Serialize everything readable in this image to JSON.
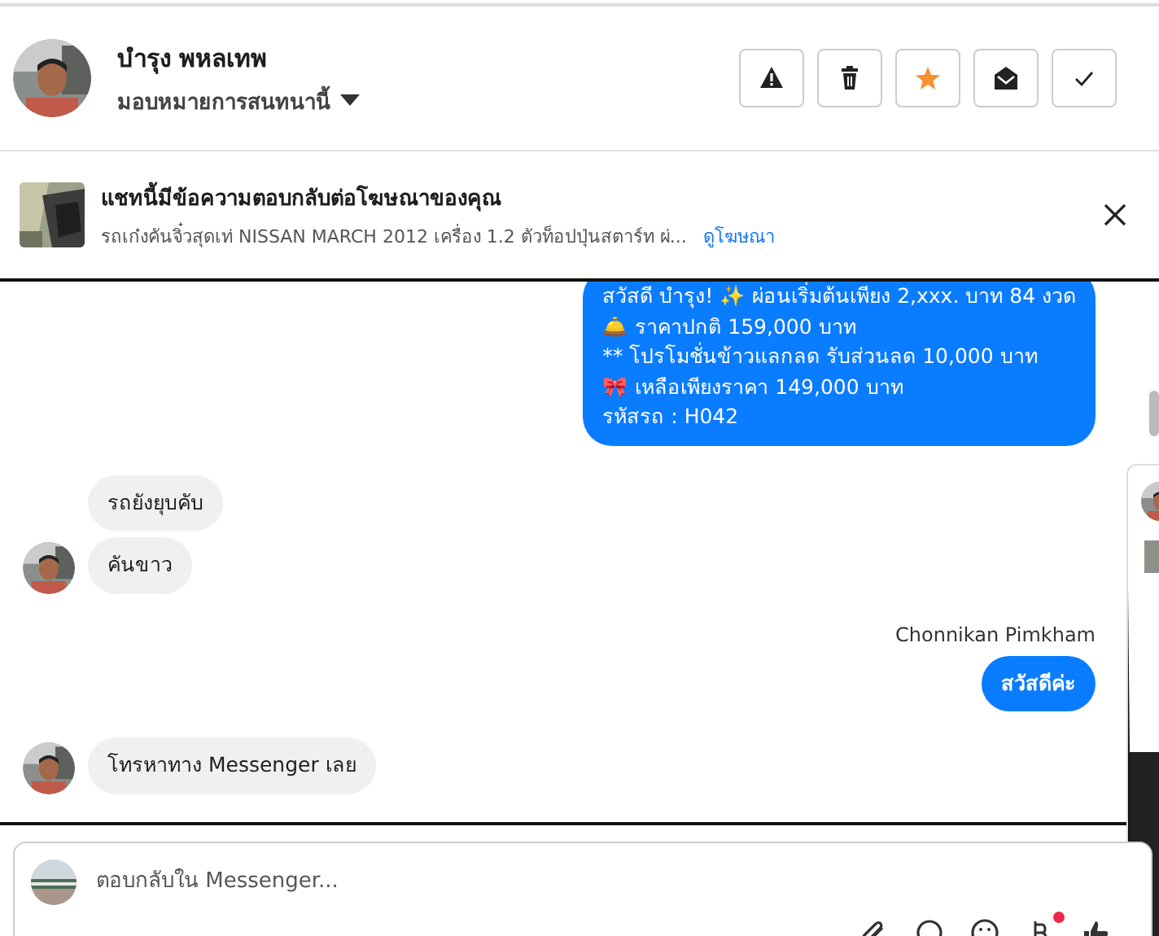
{
  "contact": {
    "name": "บำรุง พหลเทพ",
    "assign_label": "มอบหมายการสนทนานี้"
  },
  "actions": [
    {
      "kind": "spam"
    },
    {
      "kind": "trash"
    },
    {
      "kind": "star",
      "on": true
    },
    {
      "kind": "unread"
    },
    {
      "kind": "done"
    }
  ],
  "ad_banner": {
    "title": "แชทนี้มีข้อความตอบกลับต่อโฆษณาของคุณ",
    "description": "รถเก๋งคันจิ๋วสุดเท่ NISSAN MARCH 2012 เครื่อง 1.2 ตัวท็อปปุ่นสตาร์ท ผ่...",
    "link": "ดูโฆษณา"
  },
  "messages": [
    {
      "kind": "outgoing",
      "lines": [
        "สวัสดี บำรุง! ✨  ผ่อนเริ่มต้นเพียง 2,xxx. บาท 84 งวด",
        "🛎️ ราคาปกติ  159,000 บาท",
        "** โปรโมชั่นข้าวแลกลด รับส่วนลด 10,000 บาท",
        "🎀  เหลือเพียงราคา 149,000 บาท",
        " รหัสรถ : H042"
      ]
    },
    {
      "kind": "incoming",
      "lines": [
        "รถยังยุบคับ"
      ],
      "avatar": false
    },
    {
      "kind": "incoming",
      "lines": [
        "คันขาว"
      ],
      "avatar": true
    },
    {
      "kind": "outgoing",
      "sender": "Chonnikan Pimkham",
      "lines": [
        "สวัสดีค่ะ"
      ],
      "bold": true
    },
    {
      "kind": "incoming",
      "lines": [
        "โทรหาทาง Messenger เลย"
      ],
      "avatar": true
    }
  ],
  "composer": {
    "placeholder": "ตอบกลับใน Messenger..."
  },
  "composer_tools": [
    {
      "kind": "attach"
    },
    {
      "kind": "sticker"
    },
    {
      "kind": "emoji"
    },
    {
      "kind": "currency",
      "badge": true
    },
    {
      "kind": "like"
    }
  ]
}
